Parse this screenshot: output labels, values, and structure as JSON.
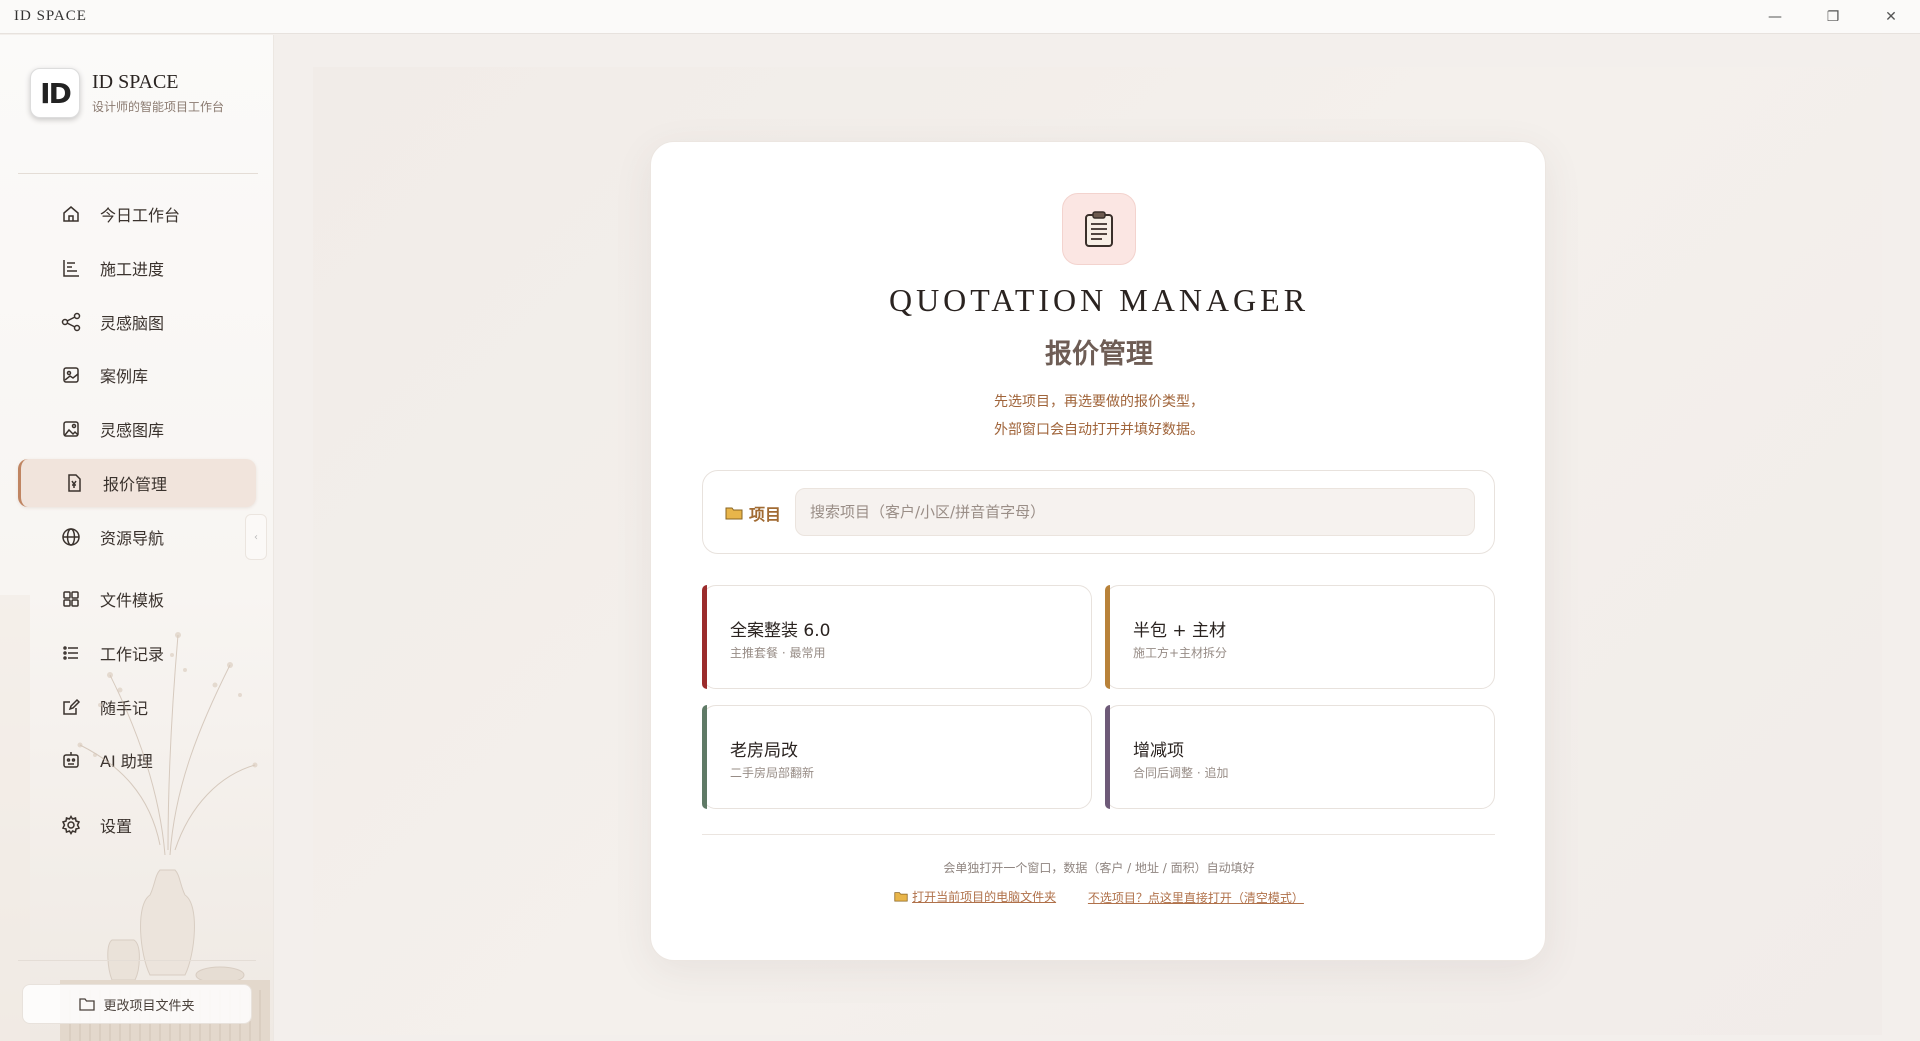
{
  "window": {
    "title": "ID SPACE",
    "controls": {
      "minimize": "—",
      "maximize": "❐",
      "close": "✕"
    }
  },
  "sidebar": {
    "logo_text": "ID",
    "brand_name": "ID SPACE",
    "brand_subtitle": "设计师的智能项目工作台",
    "items": [
      {
        "label": "今日工作台",
        "icon": "home-icon"
      },
      {
        "label": "施工进度",
        "icon": "progress-icon"
      },
      {
        "label": "灵感脑图",
        "icon": "mindmap-icon"
      },
      {
        "label": "案例库",
        "icon": "case-library-icon"
      },
      {
        "label": "灵感图库",
        "icon": "image-library-icon"
      },
      {
        "label": "报价管理",
        "icon": "quotation-icon",
        "active": true
      },
      {
        "label": "资源导航",
        "icon": "globe-icon"
      },
      {
        "label": "文件模板",
        "icon": "grid-icon"
      },
      {
        "label": "工作记录",
        "icon": "list-icon"
      },
      {
        "label": "随手记",
        "icon": "note-icon"
      },
      {
        "label": "AI 助理",
        "icon": "robot-icon"
      },
      {
        "label": "设置",
        "icon": "gear-icon"
      }
    ],
    "collapse_glyph": "‹",
    "change_folder_label": "更改项目文件夹"
  },
  "main": {
    "title": "QUOTATION MANAGER",
    "subtitle": "报价管理",
    "desc_line1": "先选项目，再选要做的报价类型，",
    "desc_line2": "外部窗口会自动打开并填好数据。",
    "project_label": "项目",
    "project_placeholder": "搜索项目（客户/小区/拼音首字母）",
    "types": [
      {
        "title": "全案整装 6.0",
        "subtitle": "主推套餐 · 最常用",
        "color": "#9b2c2c"
      },
      {
        "title": "半包 + 主材",
        "subtitle": "施工方+主材拆分",
        "color": "#b8823a"
      },
      {
        "title": "老房局改",
        "subtitle": "二手房局部翻新",
        "color": "#5f7a66"
      },
      {
        "title": "增减项",
        "subtitle": "合同后调整 · 追加",
        "color": "#6e5a78"
      }
    ],
    "footer_note": "会单独打开一个窗口，数据（客户 / 地址 / 面积）自动填好",
    "open_folder_link": "打开当前项目的电脑文件夹",
    "no_project_link": "不选项目？点这里直接打开（清空模式）"
  },
  "colors": {
    "accent": "#c08562",
    "link": "#b0714a",
    "desc": "#a0643a"
  }
}
